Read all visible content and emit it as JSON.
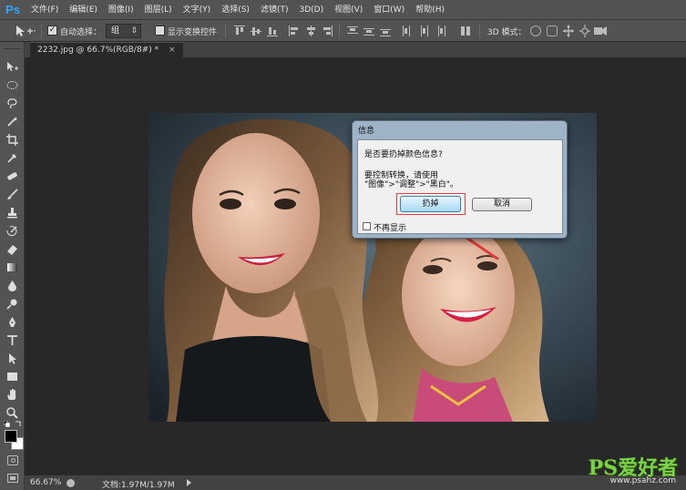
{
  "app": {
    "logo": "Ps"
  },
  "menu": [
    "文件(F)",
    "编辑(E)",
    "图像(I)",
    "图层(L)",
    "文字(Y)",
    "选择(S)",
    "滤镜(T)",
    "3D(D)",
    "视图(V)",
    "窗口(W)",
    "帮助(H)"
  ],
  "options": {
    "auto_select_label": "自动选择：",
    "auto_select_checked": true,
    "auto_select_value": "组",
    "show_transform_label": "显示变换控件",
    "show_transform_checked": false,
    "mode_3d_label": "3D 模式："
  },
  "document_tab": {
    "title": "2232.jpg @ 66.7%(RGB/8#) *",
    "close": "×"
  },
  "dialog": {
    "title": "信息",
    "question": "是否要扔掉颜色信息?",
    "instruction_line1": "要控制转换，请使用",
    "instruction_line2": "\"图像\">\"调整\">\"黑白\"。",
    "discard_label": "扔掉",
    "cancel_label": "取消",
    "dont_show_label": "不再显示",
    "dont_show_checked": false
  },
  "status": {
    "zoom": "66.67%",
    "doc_size": "文档:1.97M/1.97M"
  },
  "watermark": {
    "brand": "PS爱好者",
    "url": "www.psahz.com"
  },
  "colors": {
    "accent": "#2fa4ff",
    "highlight": "#e23b3b",
    "arrow": "#e23b3b"
  },
  "icons": [
    "move-tool-icon",
    "marquee-tool-icon",
    "lasso-tool-icon",
    "quick-select-tool-icon",
    "crop-tool-icon",
    "eyedropper-tool-icon",
    "healing-brush-tool-icon",
    "brush-tool-icon",
    "clone-stamp-tool-icon",
    "history-brush-tool-icon",
    "eraser-tool-icon",
    "gradient-tool-icon",
    "blur-tool-icon",
    "dodge-tool-icon",
    "pen-tool-icon",
    "type-tool-icon",
    "path-select-tool-icon",
    "rectangle-tool-icon",
    "hand-tool-icon",
    "zoom-tool-icon"
  ]
}
